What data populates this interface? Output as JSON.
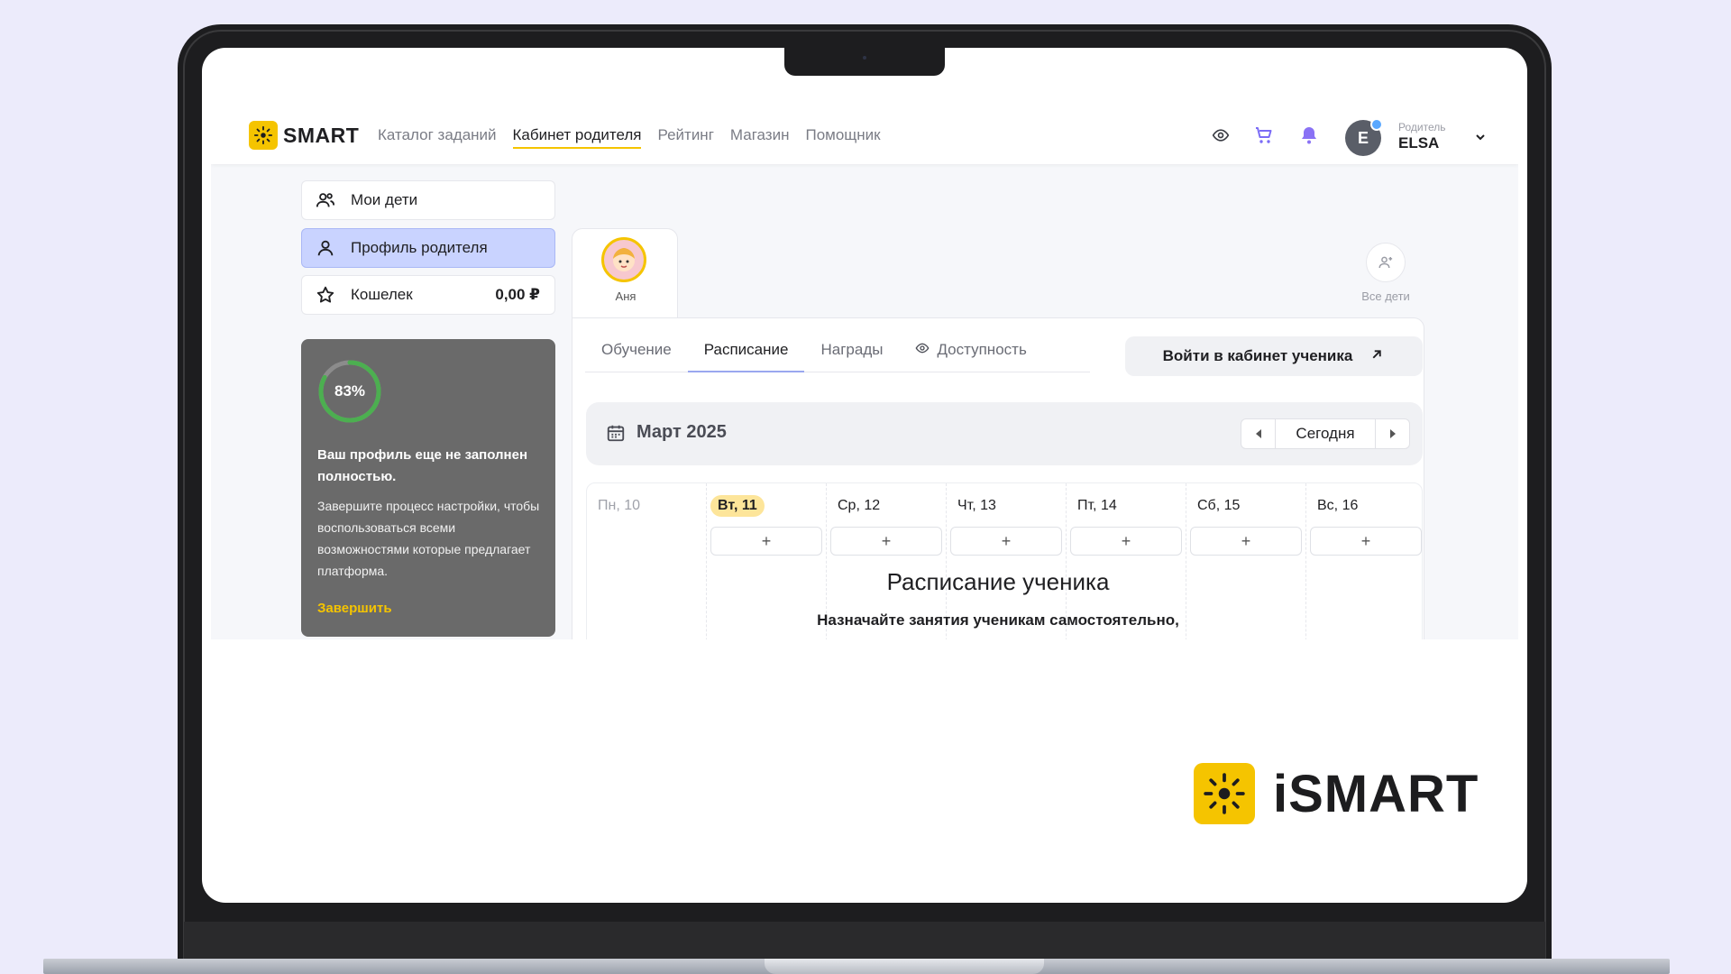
{
  "brand": {
    "name": "iSMART",
    "accent": "#f5c400"
  },
  "header": {
    "logo_text": "SMART",
    "nav": [
      {
        "label": "Каталог заданий"
      },
      {
        "label": "Кабинет родителя",
        "active": true
      },
      {
        "label": "Рейтинг"
      },
      {
        "label": "Магазин"
      },
      {
        "label": "Помощник"
      }
    ],
    "icons": [
      "eye-icon",
      "cart-icon",
      "bell-icon"
    ],
    "user": {
      "initial": "E",
      "role": "Родитель",
      "name": "ELSA"
    }
  },
  "sidebar": {
    "items": [
      {
        "label": "Мои дети",
        "icon": "children-icon"
      },
      {
        "label": "Профиль родителя",
        "icon": "user-icon",
        "active": true
      },
      {
        "label": "Кошелек",
        "icon": "star-icon",
        "amount": "0,00 ₽"
      }
    ],
    "profile_card": {
      "progress_percent": 83,
      "progress_text": "83%",
      "title": "Ваш профиль еще не заполнен полностью.",
      "text": "Завершите процесс настройки, чтобы воспользоваться всеми возможностями которые предлагает платформа.",
      "link": "Завершить",
      "colors": {
        "bg": "#6a6a6a",
        "ring": "#4caf50",
        "link": "#f5c400"
      }
    }
  },
  "children": {
    "selected": {
      "name": "Аня"
    },
    "all_label": "Все дети"
  },
  "main": {
    "tabs": [
      {
        "label": "Обучение"
      },
      {
        "label": "Расписание",
        "active": true
      },
      {
        "label": "Награды"
      },
      {
        "label": "Доступность",
        "icon": "eye-icon"
      }
    ],
    "enter_button": "Войти в кабинет ученика",
    "calendar": {
      "month": "Март 2025",
      "today_button": "Сегодня",
      "days": [
        {
          "label": "Пн, 10",
          "state": "past"
        },
        {
          "label": "Вт, 11",
          "state": "today"
        },
        {
          "label": "Ср, 12",
          "state": "future"
        },
        {
          "label": "Чт, 13",
          "state": "future"
        },
        {
          "label": "Пт, 14",
          "state": "future"
        },
        {
          "label": "Сб, 15",
          "state": "future"
        },
        {
          "label": "Вс, 16",
          "state": "future"
        }
      ],
      "add_symbol": "+"
    },
    "empty_state": {
      "title": "Расписание ученика",
      "desc": "Назначайте занятия ученикам самостоятельно,"
    }
  }
}
